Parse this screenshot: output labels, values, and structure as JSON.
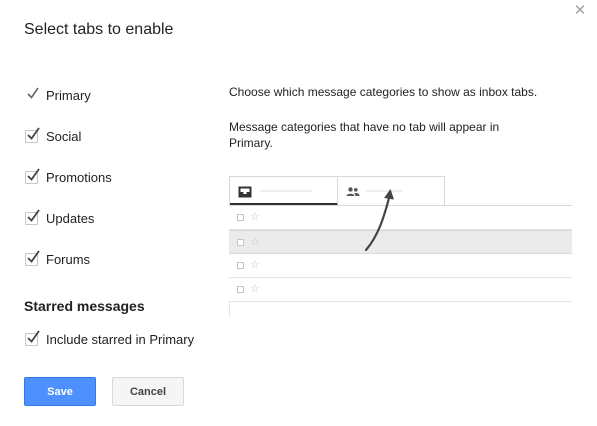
{
  "dialog": {
    "title": "Select tabs to enable",
    "close_icon": "close-icon"
  },
  "tabs": [
    {
      "label": "Primary",
      "checked": true,
      "locked": true
    },
    {
      "label": "Social",
      "checked": true,
      "locked": false
    },
    {
      "label": "Promotions",
      "checked": true,
      "locked": false
    },
    {
      "label": "Updates",
      "checked": true,
      "locked": false
    },
    {
      "label": "Forums",
      "checked": true,
      "locked": false
    }
  ],
  "starred": {
    "heading": "Starred messages",
    "option_label": "Include starred in Primary",
    "checked": true
  },
  "description": {
    "line1": "Choose which message categories to show as inbox tabs.",
    "line2": "Message categories that have no tab will appear in Primary."
  },
  "preview": {
    "tab_icons": [
      "inbox-icon",
      "people-icon"
    ],
    "row_icons": [
      "checkbox-icon",
      "star-icon"
    ]
  },
  "buttons": {
    "save": "Save",
    "cancel": "Cancel"
  },
  "colors": {
    "save_button": "#4d90fe",
    "check": "#555555"
  }
}
